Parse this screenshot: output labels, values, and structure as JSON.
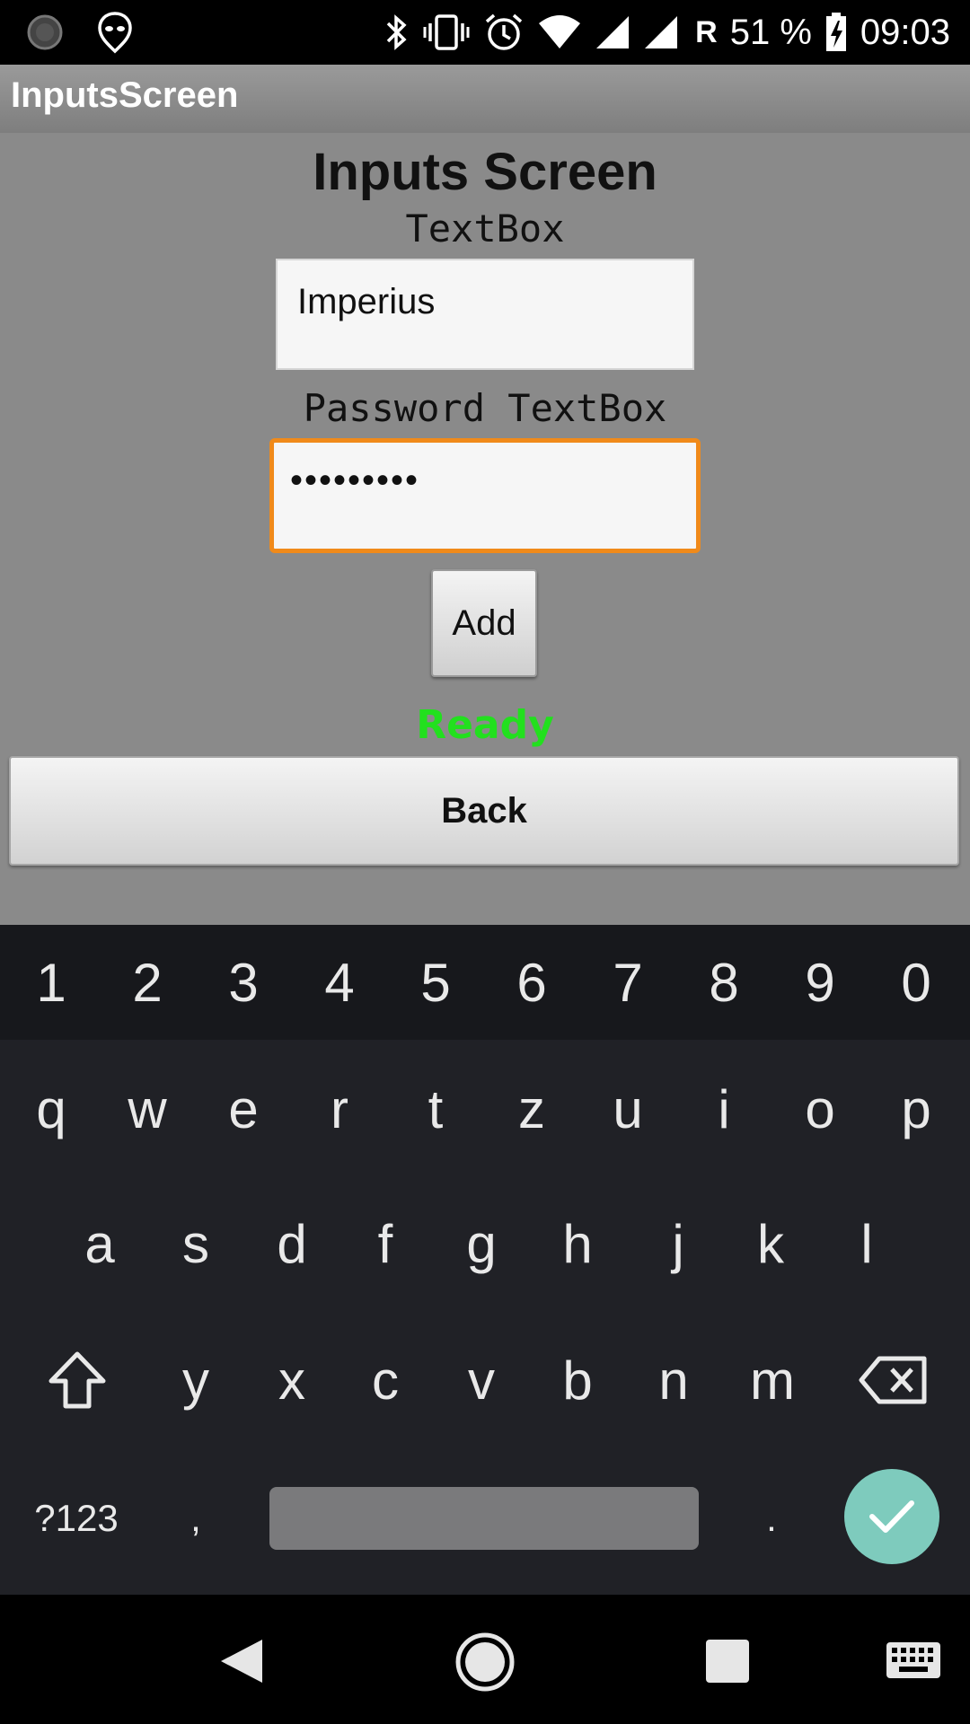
{
  "status_bar": {
    "signal_label": "R",
    "battery": "51 %",
    "time": "09:03",
    "icons": [
      "loading-icon",
      "alien-notification-icon",
      "bluetooth-icon",
      "vibrate-icon",
      "alarm-icon",
      "wifi-icon",
      "signal-icon",
      "signal-icon",
      "battery-charging-icon"
    ]
  },
  "app": {
    "title": "InputsScreen"
  },
  "screen": {
    "heading": "Inputs Screen",
    "textbox_label": "TextBox",
    "textbox_value": "Imperius",
    "password_label": "Password TextBox",
    "password_value": "•••••••••",
    "add_label": "Add",
    "status_text": "Ready",
    "status_color": "#22e01e",
    "back_label": "Back",
    "focus_color": "#f08a1a"
  },
  "keyboard": {
    "number_row": [
      "1",
      "2",
      "3",
      "4",
      "5",
      "6",
      "7",
      "8",
      "9",
      "0"
    ],
    "row1": [
      "q",
      "w",
      "e",
      "r",
      "t",
      "z",
      "u",
      "i",
      "o",
      "p"
    ],
    "row2": [
      "a",
      "s",
      "d",
      "f",
      "g",
      "h",
      "j",
      "k",
      "l"
    ],
    "row3": [
      "y",
      "x",
      "c",
      "v",
      "b",
      "n",
      "m"
    ],
    "symbols_label": "?123",
    "comma": ",",
    "period": ".",
    "enter_color": "#7ecbbd"
  },
  "nav_bar": {
    "buttons": [
      "back-icon",
      "home-icon",
      "recents-icon",
      "keyboard-icon"
    ]
  }
}
